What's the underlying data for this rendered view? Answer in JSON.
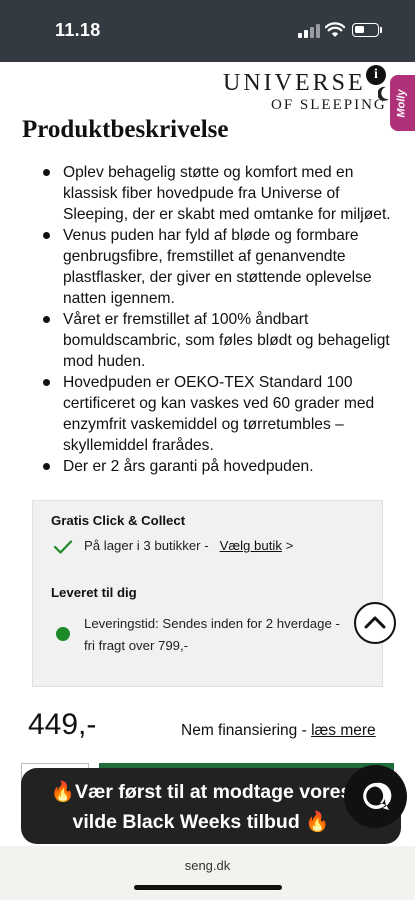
{
  "status_bar": {
    "time": "11.18"
  },
  "header": {
    "logo_line1": "UNIVERSE",
    "logo_line2": "OF SLEEPING",
    "chat_tab_label": "Molly",
    "info_icon": "info-icon"
  },
  "description": {
    "title": "Produktbeskrivelse",
    "bullets": [
      "Oplev behagelig støtte og komfort med en klassisk fiber hovedpude fra Universe of Sleeping, der er skabt med omtanke for miljøet.",
      "Venus puden har fyld af bløde og formbare genbrugsfibre, fremstillet af genanvendte plastflasker, der giver en støttende oplevelse natten igennem.",
      "Våret er fremstillet af 100% åndbart bomuldscambric, som føles blødt og behageligt mod huden.",
      "Hovedpuden er OEKO-TEX Standard 100 certificeret og kan vaskes ved 60 grader med enzymfrit vaskemiddel og tørretumbles – skyllemiddel frarådes.",
      "Der er 2 års garanti på hovedpuden."
    ]
  },
  "delivery": {
    "collect_title": "Gratis Click & Collect",
    "stock_text": "På lager i 3 butikker -",
    "choose_store_link": "Vælg butik",
    "choose_store_arrow": ">",
    "home_title": "Leveret til dig",
    "delivery_line1": "Leveringstid: Sendes inden for 2 hverdage -",
    "delivery_line2": "fri fragt over 799,-",
    "status_color": "#1d8a2a"
  },
  "price": {
    "amount": "449,-",
    "financing_text": "Nem finansiering - ",
    "financing_link": "læs mere"
  },
  "promo": {
    "line1": "🔥Vær først til at modtage vores",
    "line2": "vilde Black Weeks tilbud 🔥"
  },
  "browser": {
    "url": "seng.dk"
  },
  "colors": {
    "status_bar": "#333a42",
    "promo_bg": "#222222",
    "accent_green": "#1d8a2a",
    "chat_tab": "#b0307a"
  }
}
